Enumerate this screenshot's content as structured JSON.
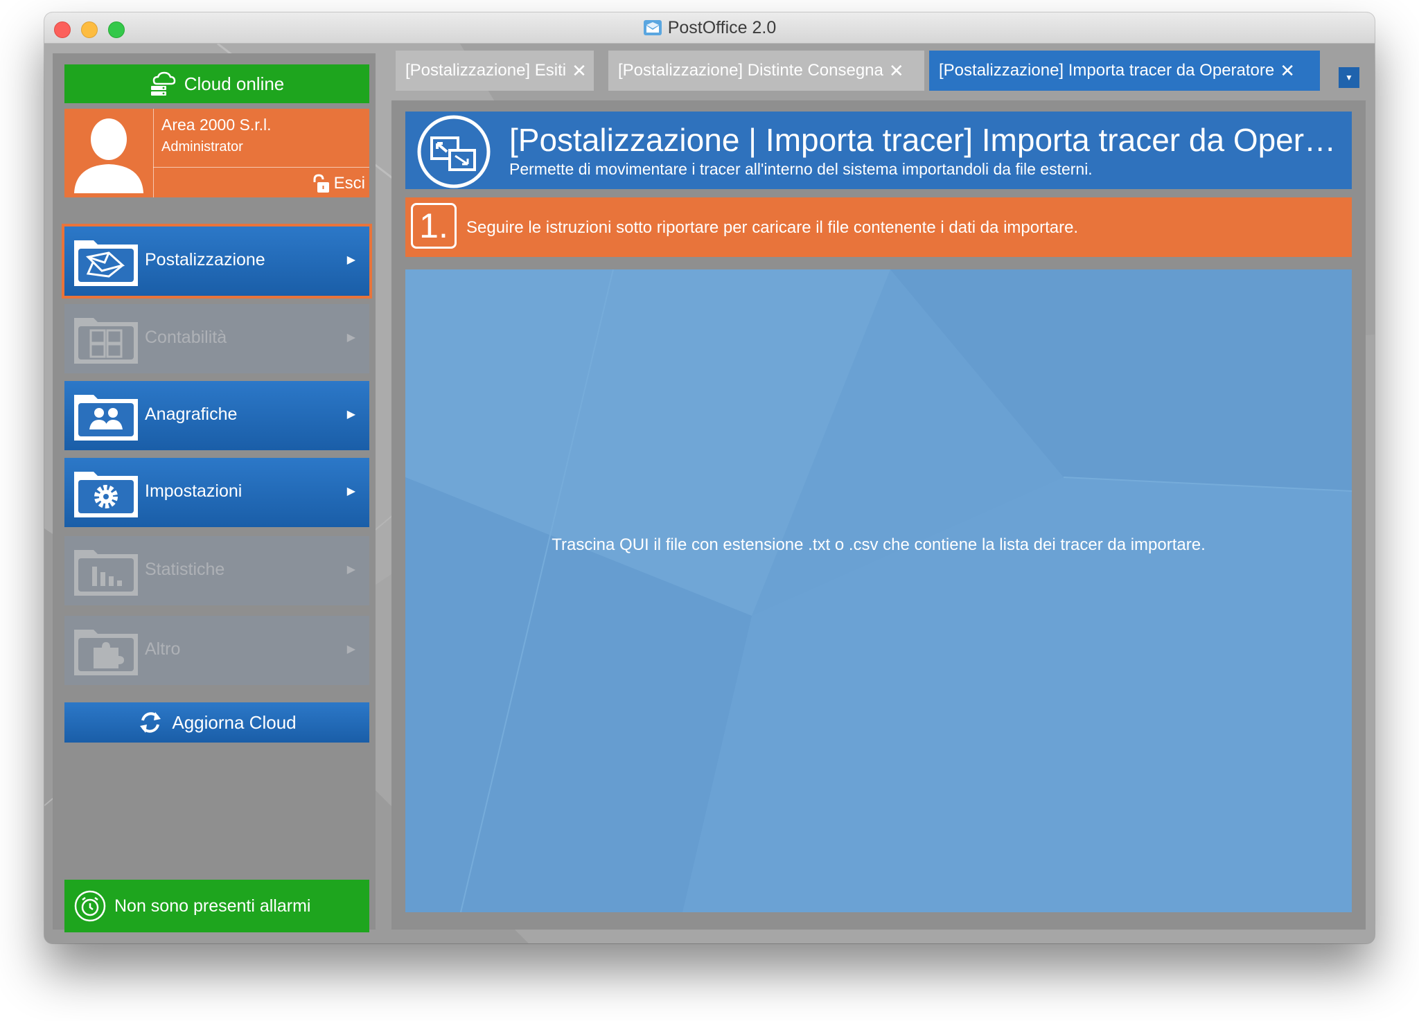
{
  "window": {
    "title": "PostOffice 2.0"
  },
  "sidebar": {
    "cloud_status": "Cloud online",
    "user": {
      "company": "Area 2000 S.r.l.",
      "role": "Administrator",
      "logout_label": "Esci"
    },
    "menu": [
      {
        "label": "Postalizzazione",
        "icon": "envelopes-icon",
        "state": "active"
      },
      {
        "label": "Contabilità",
        "icon": "calculator-icon",
        "state": "disabled"
      },
      {
        "label": "Anagrafiche",
        "icon": "users-icon",
        "state": "enabled"
      },
      {
        "label": "Impostazioni",
        "icon": "gear-icon",
        "state": "enabled"
      },
      {
        "label": "Statistiche",
        "icon": "bar-chart-icon",
        "state": "disabled"
      },
      {
        "label": "Altro",
        "icon": "puzzle-icon",
        "state": "disabled"
      }
    ],
    "arrow_glyph": "▶",
    "refresh_label": "Aggiorna Cloud",
    "alarm_label": "Non sono presenti allarmi"
  },
  "tabs": [
    {
      "label": "[Postalizzazione] Esiti",
      "active": false
    },
    {
      "label": "[Postalizzazione] Distinte Consegna",
      "active": false
    },
    {
      "label": "[Postalizzazione] Importa tracer da Operatore",
      "active": true
    }
  ],
  "close_glyph": "✕",
  "dropdown_glyph": "▼",
  "header": {
    "title": "[Postalizzazione | Importa tracer] Importa tracer da Operatore",
    "subtitle": "Permette di movimentare i tracer all'interno del sistema importandoli da file esterni."
  },
  "step": {
    "number": "1.",
    "text": "Seguire le istruzioni sotto riportare per caricare il file contenente i dati da importare."
  },
  "dropzone": {
    "text": "Trascina QUI il file con estensione .txt o .csv che contiene la lista dei tracer da importare."
  },
  "colors": {
    "accent_blue": "#2f72bd",
    "accent_orange": "#e8743b",
    "status_green": "#1ea51e",
    "dropzone_blue": "#6aa1d3"
  }
}
